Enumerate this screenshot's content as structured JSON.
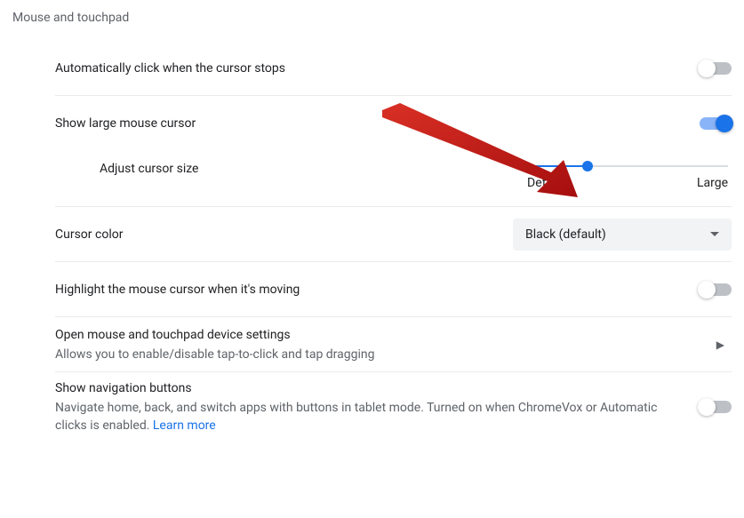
{
  "section_title": "Mouse and touchpad",
  "rows": {
    "autoclick": {
      "label": "Automatically click when the cursor stops",
      "enabled": false
    },
    "large_cursor": {
      "label": "Show large mouse cursor",
      "enabled": true
    },
    "cursor_size": {
      "label": "Adjust cursor size",
      "min_label": "Default",
      "max_label": "Large",
      "value_percent": 30
    },
    "cursor_color": {
      "label": "Cursor color",
      "selected": "Black (default)"
    },
    "highlight_moving": {
      "label": "Highlight the mouse cursor when it's moving",
      "enabled": false
    },
    "device_settings": {
      "label": "Open mouse and touchpad device settings",
      "sub": "Allows you to enable/disable tap-to-click and tap dragging"
    },
    "nav_buttons": {
      "label": "Show navigation buttons",
      "sub": "Navigate home, back, and switch apps with buttons in tablet mode. Turned on when ChromeVox or Automatic clicks is enabled.  ",
      "learn_more": "Learn more",
      "enabled": false
    }
  }
}
